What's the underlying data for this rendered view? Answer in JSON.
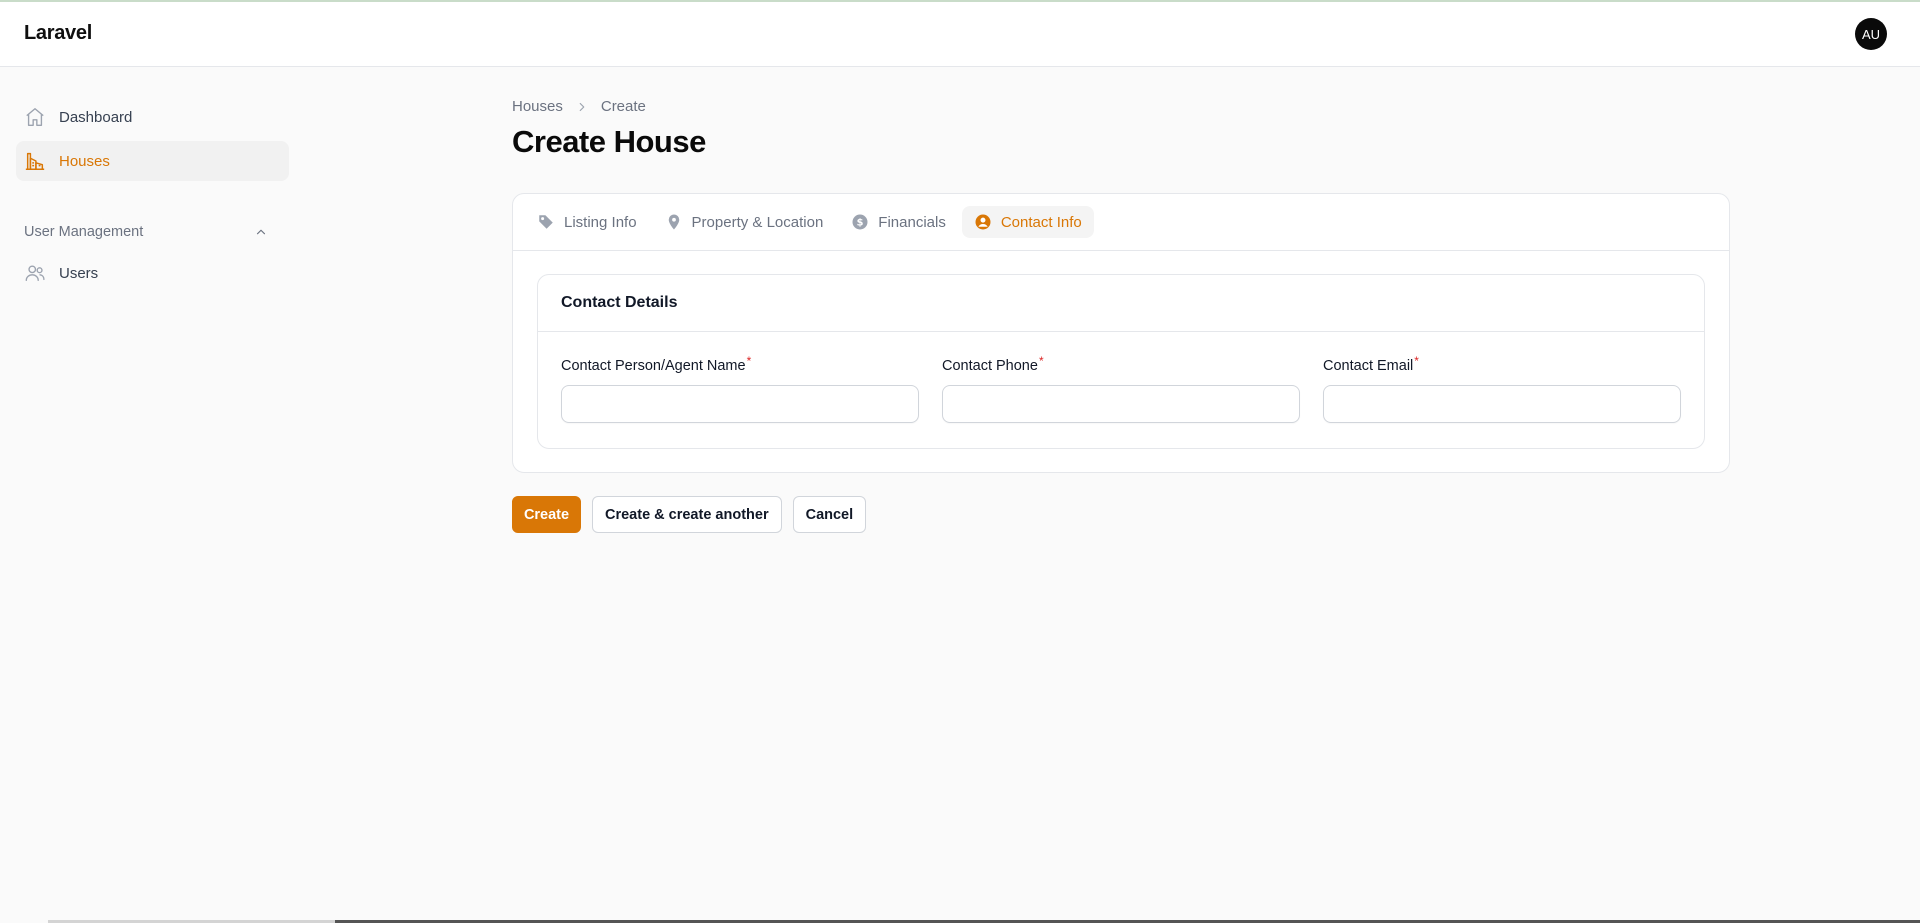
{
  "app": {
    "brand": "Laravel",
    "user_initials": "AU"
  },
  "sidebar": {
    "items": [
      {
        "label": "Dashboard",
        "icon": "home-icon",
        "active": false
      },
      {
        "label": "Houses",
        "icon": "building-icon",
        "active": true
      }
    ],
    "group": {
      "label": "User Management",
      "expanded": true,
      "items": [
        {
          "label": "Users",
          "icon": "users-icon"
        }
      ]
    }
  },
  "breadcrumb": [
    "Houses",
    "Create"
  ],
  "page": {
    "title": "Create House"
  },
  "tabs": [
    {
      "label": "Listing Info",
      "icon": "tag-icon",
      "active": false
    },
    {
      "label": "Property & Location",
      "icon": "map-pin-icon",
      "active": false
    },
    {
      "label": "Financials",
      "icon": "dollar-circle-icon",
      "active": false
    },
    {
      "label": "Contact Info",
      "icon": "user-circle-icon",
      "active": true
    }
  ],
  "section": {
    "title": "Contact Details",
    "fields": [
      {
        "label": "Contact Person/Agent Name",
        "required": "*",
        "value": "",
        "placeholder": ""
      },
      {
        "label": "Contact Phone",
        "required": "*",
        "value": "",
        "placeholder": ""
      },
      {
        "label": "Contact Email",
        "required": "*",
        "value": "",
        "placeholder": ""
      }
    ]
  },
  "actions": {
    "create": "Create",
    "create_another": "Create & create another",
    "cancel": "Cancel"
  },
  "colors": {
    "accent": "#d97706",
    "required": "#dc2626",
    "background": "#fafafa"
  }
}
